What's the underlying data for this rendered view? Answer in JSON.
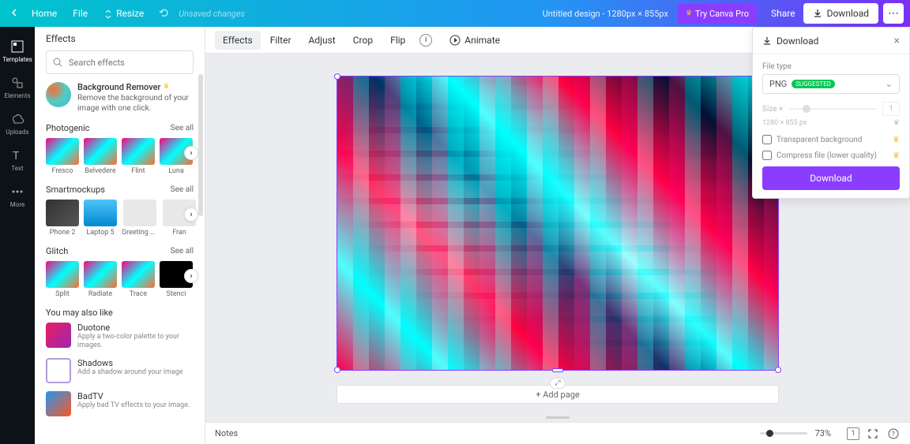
{
  "topbar": {
    "home": "Home",
    "file": "File",
    "resize": "Resize",
    "unsaved": "Unsaved changes",
    "title": "Untitled design - 1280px × 855px",
    "try_pro": "Try Canva Pro",
    "share": "Share",
    "download": "Download"
  },
  "leftnav": {
    "templates": "Templates",
    "elements": "Elements",
    "uploads": "Uploads",
    "text": "Text",
    "more": "More"
  },
  "sidepanel": {
    "header": "Effects",
    "search_placeholder": "Search effects",
    "bgremove": {
      "title": "Background Remover",
      "desc": "Remove the background of your image with one click."
    },
    "seeall": "See all",
    "photogenic": {
      "name": "Photogenic",
      "items": [
        "Fresco",
        "Belvedere",
        "Flint",
        "Luna"
      ]
    },
    "smartmockups": {
      "name": "Smartmockups",
      "items": [
        "Phone 2",
        "Laptop 5",
        "Greeting car...",
        "Fran"
      ]
    },
    "glitch": {
      "name": "Glitch",
      "items": [
        "Split",
        "Radiate",
        "Trace",
        "Stenci"
      ]
    },
    "maylike": {
      "title": "You may also like",
      "duotone": {
        "t": "Duotone",
        "d": "Apply a two-color palette to your images."
      },
      "shadows": {
        "t": "Shadows",
        "d": "Add a shadow around your image"
      },
      "badtv": {
        "t": "BadTV",
        "d": "Apply bad TV effects to your image."
      }
    }
  },
  "toolbar": {
    "effects": "Effects",
    "filter": "Filter",
    "adjust": "Adjust",
    "crop": "Crop",
    "flip": "Flip",
    "animate": "Animate"
  },
  "addpage": "+ Add page",
  "footer": {
    "notes": "Notes",
    "zoom": "73%",
    "page_count": "1"
  },
  "download_panel": {
    "title": "Download",
    "filetype_label": "File type",
    "filetype": "PNG",
    "suggested": "SUGGESTED",
    "size_label": "Size ×",
    "size_value": "1",
    "dims": "1280 × 855 px",
    "transparent": "Transparent background",
    "compress": "Compress file (lower quality)",
    "button": "Download"
  }
}
